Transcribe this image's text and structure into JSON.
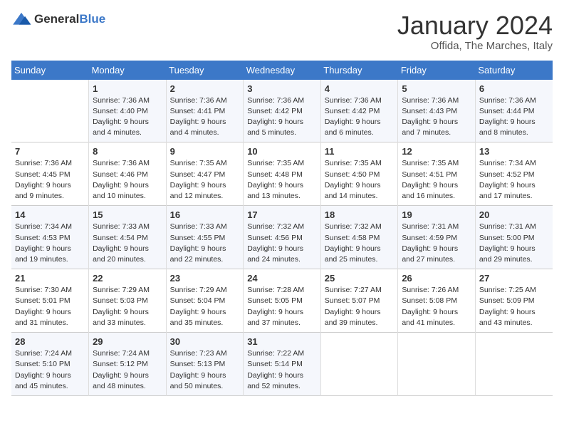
{
  "logo": {
    "general": "General",
    "blue": "Blue"
  },
  "title": "January 2024",
  "location": "Offida, The Marches, Italy",
  "weekdays": [
    "Sunday",
    "Monday",
    "Tuesday",
    "Wednesday",
    "Thursday",
    "Friday",
    "Saturday"
  ],
  "weeks": [
    [
      {
        "day": "",
        "info": ""
      },
      {
        "day": "1",
        "info": "Sunrise: 7:36 AM\nSunset: 4:40 PM\nDaylight: 9 hours\nand 4 minutes."
      },
      {
        "day": "2",
        "info": "Sunrise: 7:36 AM\nSunset: 4:41 PM\nDaylight: 9 hours\nand 4 minutes."
      },
      {
        "day": "3",
        "info": "Sunrise: 7:36 AM\nSunset: 4:42 PM\nDaylight: 9 hours\nand 5 minutes."
      },
      {
        "day": "4",
        "info": "Sunrise: 7:36 AM\nSunset: 4:42 PM\nDaylight: 9 hours\nand 6 minutes."
      },
      {
        "day": "5",
        "info": "Sunrise: 7:36 AM\nSunset: 4:43 PM\nDaylight: 9 hours\nand 7 minutes."
      },
      {
        "day": "6",
        "info": "Sunrise: 7:36 AM\nSunset: 4:44 PM\nDaylight: 9 hours\nand 8 minutes."
      }
    ],
    [
      {
        "day": "7",
        "info": "Sunrise: 7:36 AM\nSunset: 4:45 PM\nDaylight: 9 hours\nand 9 minutes."
      },
      {
        "day": "8",
        "info": "Sunrise: 7:36 AM\nSunset: 4:46 PM\nDaylight: 9 hours\nand 10 minutes."
      },
      {
        "day": "9",
        "info": "Sunrise: 7:35 AM\nSunset: 4:47 PM\nDaylight: 9 hours\nand 12 minutes."
      },
      {
        "day": "10",
        "info": "Sunrise: 7:35 AM\nSunset: 4:48 PM\nDaylight: 9 hours\nand 13 minutes."
      },
      {
        "day": "11",
        "info": "Sunrise: 7:35 AM\nSunset: 4:50 PM\nDaylight: 9 hours\nand 14 minutes."
      },
      {
        "day": "12",
        "info": "Sunrise: 7:35 AM\nSunset: 4:51 PM\nDaylight: 9 hours\nand 16 minutes."
      },
      {
        "day": "13",
        "info": "Sunrise: 7:34 AM\nSunset: 4:52 PM\nDaylight: 9 hours\nand 17 minutes."
      }
    ],
    [
      {
        "day": "14",
        "info": "Sunrise: 7:34 AM\nSunset: 4:53 PM\nDaylight: 9 hours\nand 19 minutes."
      },
      {
        "day": "15",
        "info": "Sunrise: 7:33 AM\nSunset: 4:54 PM\nDaylight: 9 hours\nand 20 minutes."
      },
      {
        "day": "16",
        "info": "Sunrise: 7:33 AM\nSunset: 4:55 PM\nDaylight: 9 hours\nand 22 minutes."
      },
      {
        "day": "17",
        "info": "Sunrise: 7:32 AM\nSunset: 4:56 PM\nDaylight: 9 hours\nand 24 minutes."
      },
      {
        "day": "18",
        "info": "Sunrise: 7:32 AM\nSunset: 4:58 PM\nDaylight: 9 hours\nand 25 minutes."
      },
      {
        "day": "19",
        "info": "Sunrise: 7:31 AM\nSunset: 4:59 PM\nDaylight: 9 hours\nand 27 minutes."
      },
      {
        "day": "20",
        "info": "Sunrise: 7:31 AM\nSunset: 5:00 PM\nDaylight: 9 hours\nand 29 minutes."
      }
    ],
    [
      {
        "day": "21",
        "info": "Sunrise: 7:30 AM\nSunset: 5:01 PM\nDaylight: 9 hours\nand 31 minutes."
      },
      {
        "day": "22",
        "info": "Sunrise: 7:29 AM\nSunset: 5:03 PM\nDaylight: 9 hours\nand 33 minutes."
      },
      {
        "day": "23",
        "info": "Sunrise: 7:29 AM\nSunset: 5:04 PM\nDaylight: 9 hours\nand 35 minutes."
      },
      {
        "day": "24",
        "info": "Sunrise: 7:28 AM\nSunset: 5:05 PM\nDaylight: 9 hours\nand 37 minutes."
      },
      {
        "day": "25",
        "info": "Sunrise: 7:27 AM\nSunset: 5:07 PM\nDaylight: 9 hours\nand 39 minutes."
      },
      {
        "day": "26",
        "info": "Sunrise: 7:26 AM\nSunset: 5:08 PM\nDaylight: 9 hours\nand 41 minutes."
      },
      {
        "day": "27",
        "info": "Sunrise: 7:25 AM\nSunset: 5:09 PM\nDaylight: 9 hours\nand 43 minutes."
      }
    ],
    [
      {
        "day": "28",
        "info": "Sunrise: 7:24 AM\nSunset: 5:10 PM\nDaylight: 9 hours\nand 45 minutes."
      },
      {
        "day": "29",
        "info": "Sunrise: 7:24 AM\nSunset: 5:12 PM\nDaylight: 9 hours\nand 48 minutes."
      },
      {
        "day": "30",
        "info": "Sunrise: 7:23 AM\nSunset: 5:13 PM\nDaylight: 9 hours\nand 50 minutes."
      },
      {
        "day": "31",
        "info": "Sunrise: 7:22 AM\nSunset: 5:14 PM\nDaylight: 9 hours\nand 52 minutes."
      },
      {
        "day": "",
        "info": ""
      },
      {
        "day": "",
        "info": ""
      },
      {
        "day": "",
        "info": ""
      }
    ]
  ]
}
